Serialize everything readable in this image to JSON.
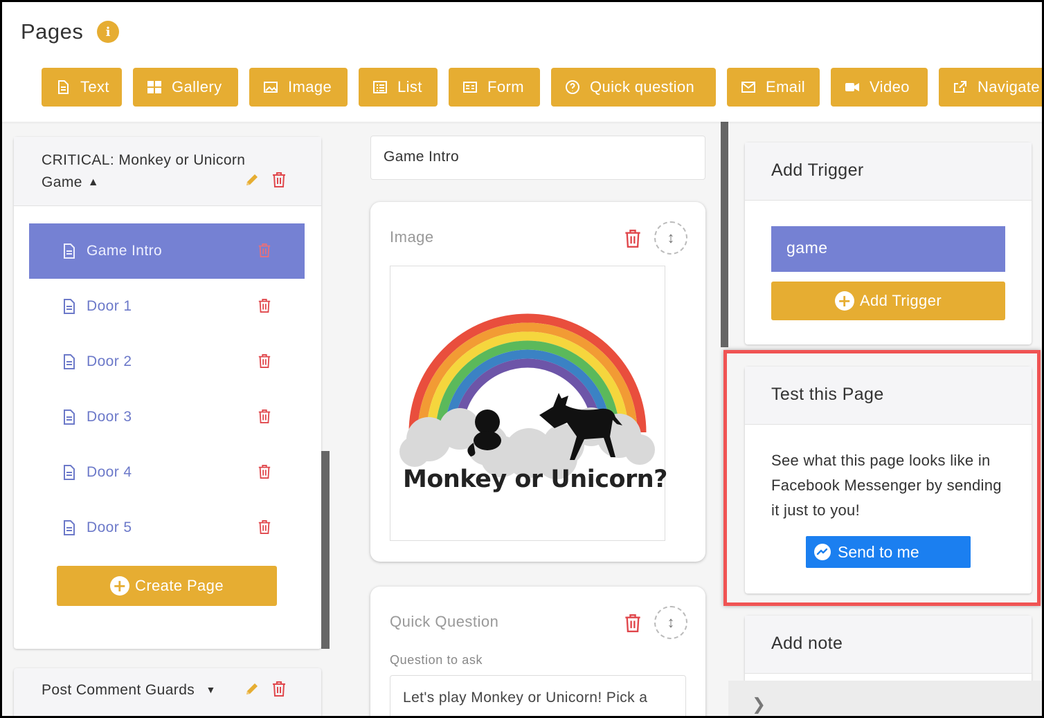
{
  "header": {
    "title": "Pages",
    "info_icon": "info-icon",
    "accent": "#e6ad32"
  },
  "toolbar": [
    {
      "label": "Text",
      "icon": "text-doc-icon"
    },
    {
      "label": "Gallery",
      "icon": "gallery-grid-icon"
    },
    {
      "label": "Image",
      "icon": "image-icon"
    },
    {
      "label": "List",
      "icon": "list-icon"
    },
    {
      "label": "Form",
      "icon": "form-card-icon"
    },
    {
      "label": "Quick question",
      "icon": "question-circle-icon"
    },
    {
      "label": "Email",
      "icon": "envelope-icon"
    },
    {
      "label": "Video",
      "icon": "video-camera-icon"
    },
    {
      "label": "Navigate",
      "icon": "share-arrow-icon"
    }
  ],
  "sidebar": {
    "group_title": "CRITICAL: Monkey or Unicorn Game",
    "group_title_line1": "CRITICAL: Monkey or Unicorn",
    "group_title_line2": "Game",
    "pages": [
      {
        "label": "Game Intro",
        "selected": true
      },
      {
        "label": "Door 1",
        "selected": false
      },
      {
        "label": "Door 2",
        "selected": false
      },
      {
        "label": "Door 3",
        "selected": false
      },
      {
        "label": "Door 4",
        "selected": false
      },
      {
        "label": "Door 5",
        "selected": false
      }
    ],
    "create_label": "Create Page",
    "group2_title": "Post Comment Guards"
  },
  "editor": {
    "page_name": "Game Intro",
    "image_card": {
      "title": "Image",
      "image_caption": "Monkey or Unicorn?"
    },
    "question_card": {
      "title": "Quick Question",
      "label": "Question to ask",
      "value": "Let's play Monkey or Unicorn! Pick a"
    }
  },
  "right": {
    "trigger_title": "Add Trigger",
    "trigger_value": "game",
    "add_trigger_label": "Add Trigger",
    "test_title": "Test this Page",
    "test_desc": "See what this page looks like in Facebook Messenger by sending it just to you!",
    "send_label": "Send to me",
    "note_title": "Add note"
  },
  "colors": {
    "accent": "#e6ad32",
    "selected": "#7581d3",
    "messenger": "#1b7ff0",
    "highlight": "#f05353",
    "danger": "#e0474c"
  }
}
